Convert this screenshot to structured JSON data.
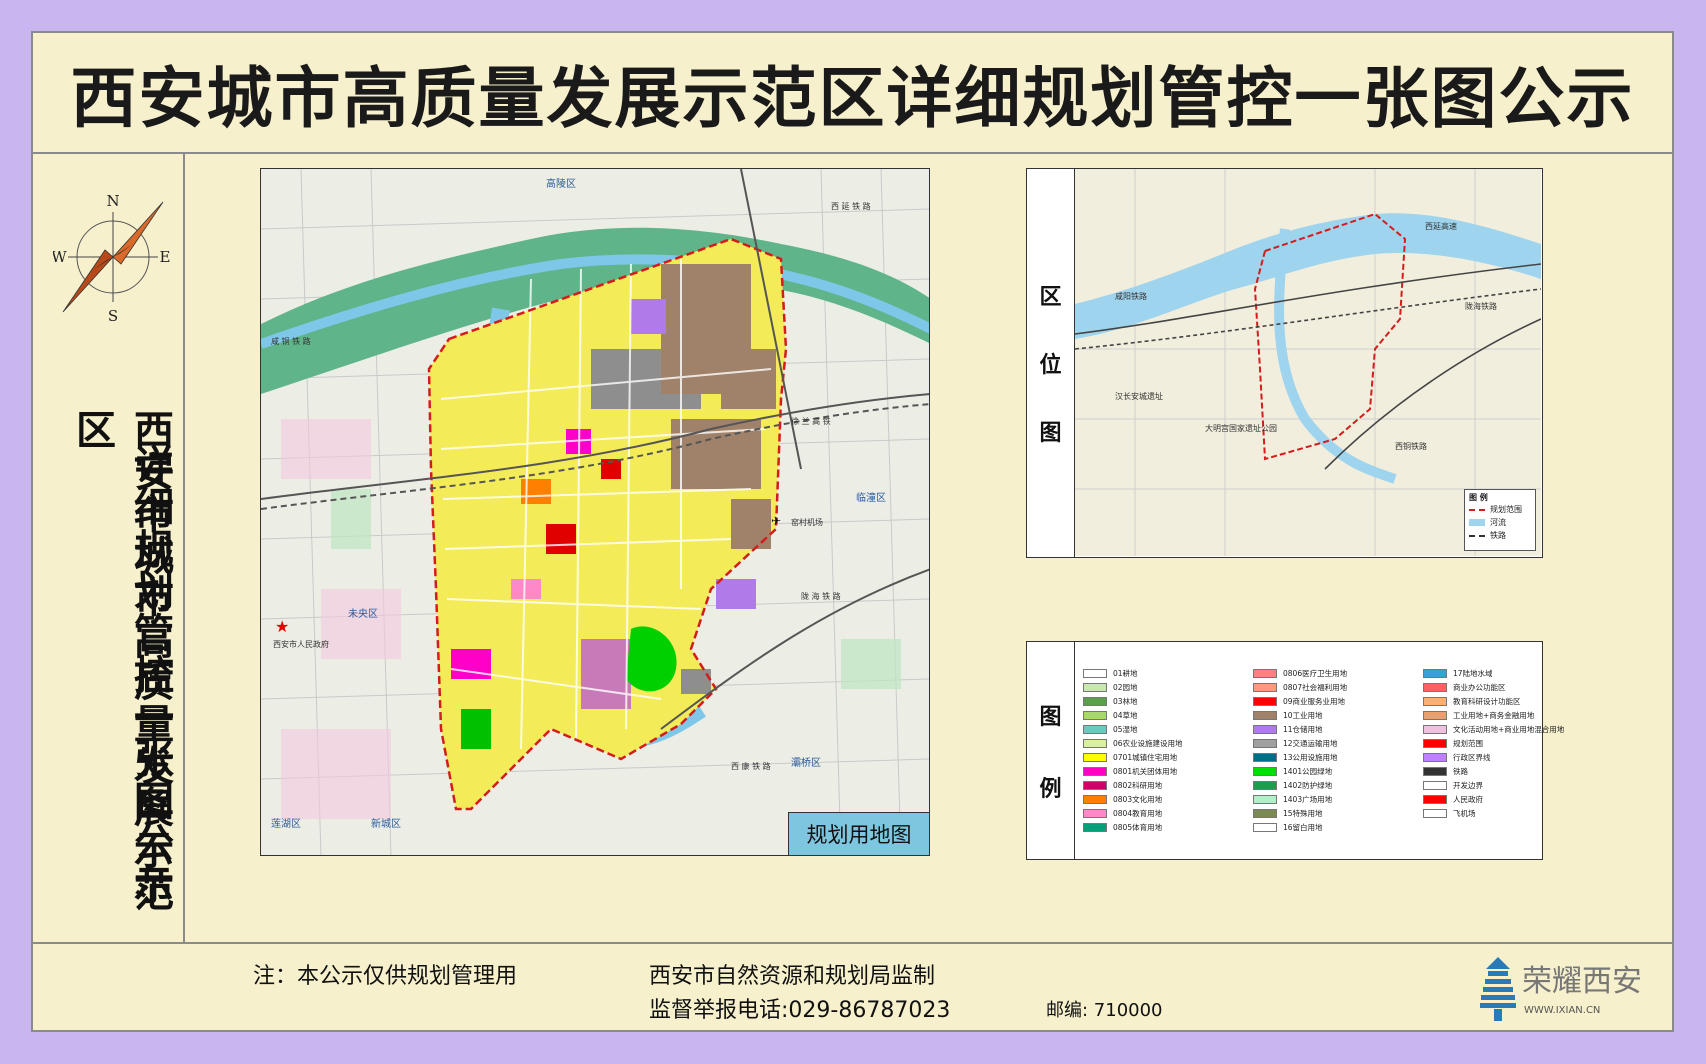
{
  "title": "西安城市高质量发展示范区详细规划管控一张图公示",
  "side_title_main": "西安市城市高质量发展示范区",
  "side_title_sub": "详细规划管控一张图公示",
  "compass": {
    "n": "N",
    "s": "S",
    "e": "E",
    "w": "W"
  },
  "main_map": {
    "tag": "规划用地图",
    "labels": {
      "gaoling": "高陵区",
      "lintong": "临潼区",
      "weiyang": "未央区",
      "baqiao": "灞桥区",
      "lianhu": "莲湖区",
      "xincheng": "新城区",
      "airport": "窑村机场",
      "gov": "西安市人民政府",
      "rail1": "咸 铜 铁 路",
      "rail2": "西 延 铁 路",
      "rail3": "陇 海 铁 路",
      "rail4": "徐 兰 高 铁",
      "rail5": "西 康 铁 路"
    }
  },
  "locator": {
    "side_label": [
      "区",
      "位",
      "图"
    ],
    "labels": {
      "han_site": "汉长安城遗址",
      "daming": "大明宫国家遗址公园",
      "xiyan": "西延高速",
      "xixian": "咸阳铁路",
      "longhai": "陇海铁路",
      "xitong": "西铜铁路"
    },
    "legend_title": "图 例",
    "legend": [
      {
        "label": "规划范围"
      },
      {
        "label": "河流"
      },
      {
        "label": "铁路"
      }
    ]
  },
  "legend": {
    "side_label": [
      "图",
      "例"
    ],
    "col1": [
      {
        "label": "01耕地",
        "color": "#ffffff"
      },
      {
        "label": "02园地",
        "color": "#c8e8b0"
      },
      {
        "label": "03林地",
        "color": "#5aa04a"
      },
      {
        "label": "04草地",
        "color": "#a6d86a"
      },
      {
        "label": "05湿地",
        "color": "#6ec8c0"
      },
      {
        "label": "06农业设施建设用地",
        "color": "#d8f0a0"
      },
      {
        "label": "0701城镇住宅用地",
        "color": "#ffff00"
      },
      {
        "label": "0801机关团体用地",
        "color": "#ff00c8"
      },
      {
        "label": "0802科研用地",
        "color": "#d0006a"
      },
      {
        "label": "0803文化用地",
        "color": "#ff7f00"
      },
      {
        "label": "0804教育用地",
        "color": "#ff88c8"
      },
      {
        "label": "0805体育用地",
        "color": "#00a07a"
      }
    ],
    "col2": [
      {
        "label": "0806医疗卫生用地",
        "color": "#ff8080"
      },
      {
        "label": "0807社会福利用地",
        "color": "#ff9a7a"
      },
      {
        "label": "09商业服务业用地",
        "color": "#ff0000"
      },
      {
        "label": "10工业用地",
        "color": "#a0826a"
      },
      {
        "label": "11仓储用地",
        "color": "#b07ae8"
      },
      {
        "label": "12交通运输用地",
        "color": "#a0a0a0"
      },
      {
        "label": "13公用设施用地",
        "color": "#006e8c"
      },
      {
        "label": "1401公园绿地",
        "color": "#00e000"
      },
      {
        "label": "1402防护绿地",
        "color": "#1e9e4a"
      },
      {
        "label": "1403广场用地",
        "color": "#b0f0c8"
      },
      {
        "label": "15特殊用地",
        "color": "#7a8a50"
      },
      {
        "label": "16留白用地",
        "color": "#ffffff"
      }
    ],
    "col3": [
      {
        "label": "17陆地水域",
        "color": "#3aa0d0"
      },
      {
        "label": "商业办公功能区",
        "color": "#ff6060"
      },
      {
        "label": "教育科研设计功能区",
        "color": "#ffb070"
      },
      {
        "label": "工业用地+商务金融用地",
        "color": "#e8a070"
      },
      {
        "label": "文化活动用地+商业用地混合用地",
        "color": "#f0c0e0"
      },
      {
        "label": "规划范围",
        "color": "#ff0000"
      },
      {
        "label": "行政区界线",
        "color": "#c080ff"
      },
      {
        "label": "铁路",
        "color": "#333333"
      },
      {
        "label": "开发边界",
        "color": "#ffffff"
      },
      {
        "label": "人民政府",
        "color": "#ff0000"
      },
      {
        "label": "飞机场",
        "color": "#ffffff"
      }
    ]
  },
  "footer": {
    "note": "注：本公示仅供规划管理用",
    "authority": "西安市自然资源和规划局监制",
    "phone": "监督举报电话:029-86787023",
    "postcode": "邮编: 710000"
  },
  "logo": {
    "text": "荣耀西安",
    "url": "WWW.IXIAN.CN"
  }
}
